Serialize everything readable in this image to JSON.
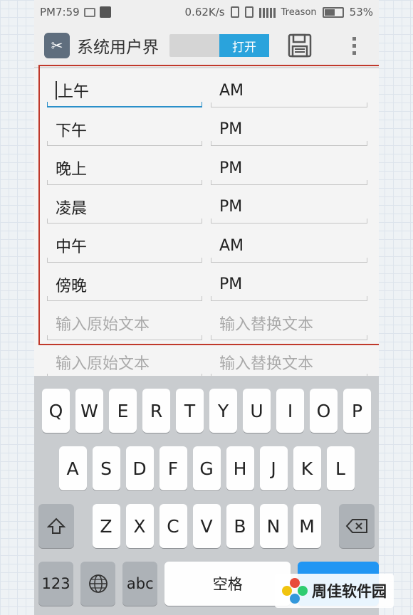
{
  "status_bar": {
    "time": "PM7:59",
    "speed": "0.62K/s",
    "carrier": "Treason",
    "battery": "53%"
  },
  "app_bar": {
    "title": "系统用户界",
    "toggle_label": "打开",
    "save_icon": "save-icon",
    "more_icon": "overflow-menu-icon",
    "accent": "#2aa3dc"
  },
  "rows": [
    {
      "original": "上午",
      "replacement": "AM"
    },
    {
      "original": "下午",
      "replacement": "PM"
    },
    {
      "original": "晚上",
      "replacement": "PM"
    },
    {
      "original": "凌晨",
      "replacement": "PM"
    },
    {
      "original": "中午",
      "replacement": "AM"
    },
    {
      "original": "傍晚",
      "replacement": "PM"
    }
  ],
  "placeholders": {
    "original": "输入原始文本",
    "replacement": "输入替换文本"
  },
  "keyboard": {
    "row1": [
      "Q",
      "W",
      "E",
      "R",
      "T",
      "Y",
      "U",
      "I",
      "O",
      "P"
    ],
    "row2": [
      "A",
      "S",
      "D",
      "F",
      "G",
      "H",
      "J",
      "K",
      "L"
    ],
    "row3": [
      "Z",
      "X",
      "C",
      "V",
      "B",
      "N",
      "M"
    ],
    "key_123": "123",
    "key_abc": "abc",
    "space": "空格"
  },
  "watermark": {
    "text": "周佳软件园"
  },
  "colors": {
    "highlight": "#c0392b",
    "keyboard_bg": "#c9cccf",
    "enter_key": "#2196f3"
  }
}
